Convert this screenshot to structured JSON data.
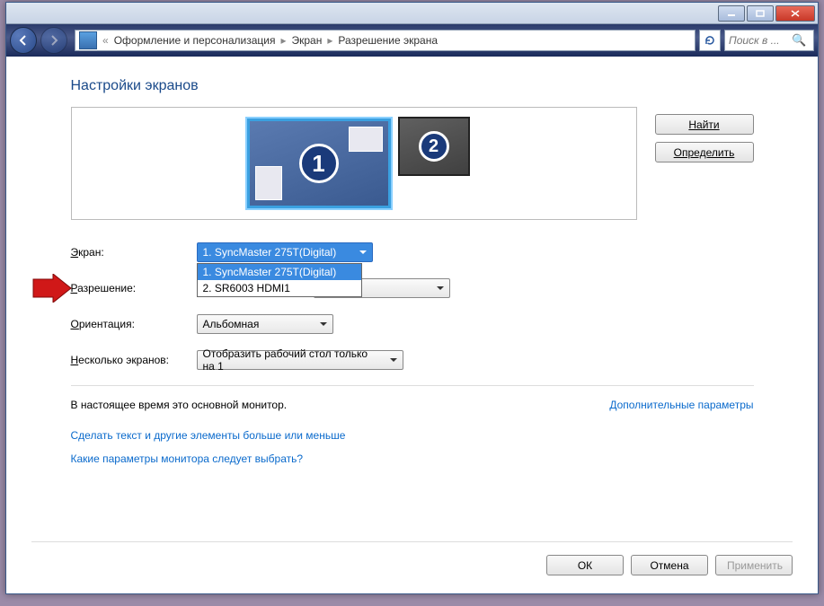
{
  "breadcrumb": {
    "item1": "Оформление и персонализация",
    "item2": "Экран",
    "item3": "Разрешение экрана"
  },
  "search": {
    "placeholder": "Поиск в ..."
  },
  "heading": "Настройки экранов",
  "monitors": {
    "num1": "1",
    "num2": "2"
  },
  "buttons": {
    "find": "Найти",
    "detect": "Определить",
    "ok": "ОК",
    "cancel": "Отмена",
    "apply": "Применить"
  },
  "labels": {
    "screen_u": "Э",
    "screen_rest": "кран:",
    "resolution_u": "Р",
    "resolution_rest": "азрешение:",
    "orientation_u": "О",
    "orientation_rest": "риентация:",
    "multi_u": "Н",
    "multi_rest": "есколько экранов:"
  },
  "combos": {
    "screen_selected": "1. SyncMaster 275T(Digital)",
    "screen_options": {
      "opt1": "1. SyncMaster 275T(Digital)",
      "opt2": "2. SR6003 HDMI1"
    },
    "orientation": "Альбомная",
    "multi": "Отобразить рабочий стол только на 1"
  },
  "status": "В настоящее время это основной монитор.",
  "links": {
    "advanced": "Дополнительные параметры",
    "bigger": "Сделать текст и другие элементы больше или меньше",
    "which": "Какие параметры монитора следует выбрать?"
  }
}
